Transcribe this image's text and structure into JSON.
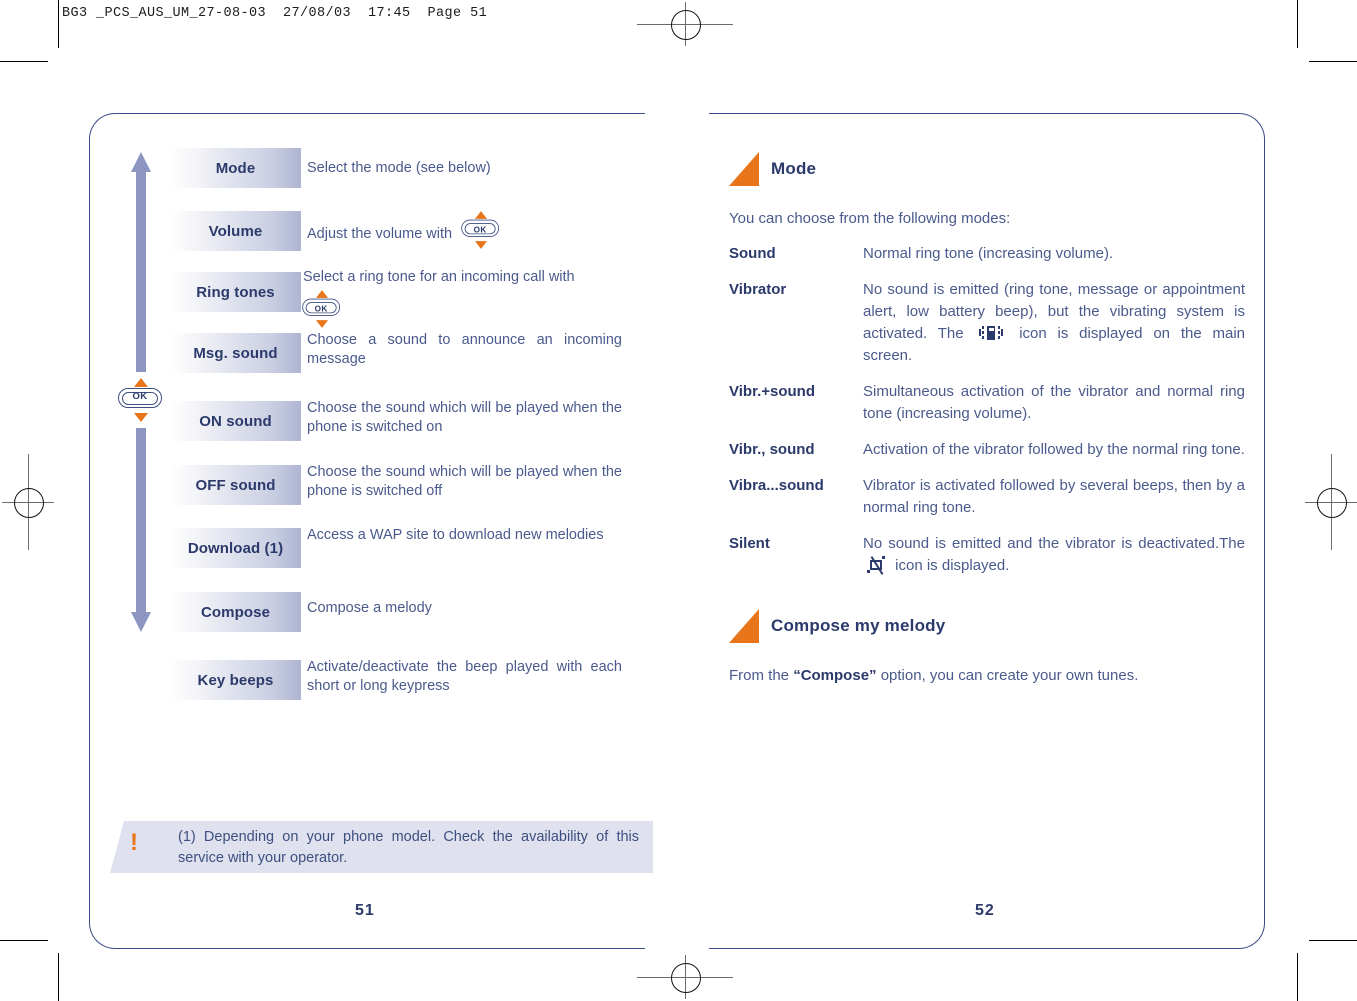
{
  "slug": "BG3 _PCS_AUS_UM_27-08-03  27/08/03  17:45  Page 51",
  "colors": {
    "accent_orange": "#e8751a",
    "text_blue": "#4a5a8c",
    "heading_blue": "#2b3a6b",
    "border_blue": "#3a4a86",
    "button_gradient_end": "#aeb5d2",
    "note_bg": "#dfe2ee"
  },
  "left_page": {
    "page_number": "51",
    "menu": [
      {
        "label": "Mode",
        "desc": "Select the mode (see below)",
        "ok_key": false
      },
      {
        "label": "Volume",
        "desc": "Adjust the volume with ",
        "ok_key": true
      },
      {
        "label": "Ring tones",
        "desc": "Select a ring tone for an incoming call with ",
        "ok_key": true
      },
      {
        "label": "Msg. sound",
        "desc": "Choose a sound to announce an incoming message",
        "ok_key": false
      },
      {
        "label": "ON sound",
        "desc": "Choose the sound which will be played when the phone is switched on",
        "ok_key": false
      },
      {
        "label": "OFF sound",
        "desc": "Choose the sound which will be played when the phone is switched off",
        "ok_key": false
      },
      {
        "label": "Download (1)",
        "desc": "Access a WAP site to download new melodies",
        "ok_key": false
      },
      {
        "label": "Compose",
        "desc": "Compose a melody",
        "ok_key": false
      },
      {
        "label": "Key beeps",
        "desc": "Activate/deactivate the beep played with each short or long keypress",
        "ok_key": false
      }
    ],
    "ok_key_label": "OK",
    "footnote": {
      "marker": "!",
      "line1": "(1) Depending on your phone model. Check the",
      "line2": "availability of this service with your operator."
    }
  },
  "right_page": {
    "page_number": "52",
    "section_mode": {
      "heading": "Mode",
      "lead": "You can choose from the following modes:",
      "modes": [
        {
          "term": "Sound",
          "def_before": "Normal ring tone (increasing volume).",
          "icon": null,
          "def_after": ""
        },
        {
          "term": "Vibrator",
          "def_before": "No sound is emitted (ring tone, message or appointment alert, low battery beep), but the vibrating system is activated. The ",
          "icon": "vibrate-icon",
          "def_after": " icon is displayed on the main screen."
        },
        {
          "term": "Vibr.+sound",
          "def_before": "Simultaneous activation of the vibrator and normal ring tone (increasing volume).",
          "icon": null,
          "def_after": ""
        },
        {
          "term": "Vibr., sound",
          "def_before": "Activation of the vibrator followed by the normal ring tone.",
          "icon": null,
          "def_after": ""
        },
        {
          "term": "Vibra...sound",
          "def_before": "Vibrator is activated followed by several beeps, then by a normal ring tone.",
          "icon": null,
          "def_after": ""
        },
        {
          "term": "Silent",
          "def_before": "No sound is emitted and the vibrator is deactivated.The ",
          "icon": "silent-icon",
          "def_after": " icon is displayed."
        }
      ]
    },
    "section_compose": {
      "heading": "Compose my melody",
      "text_before": "From the ",
      "text_bold": "“Compose”",
      "text_after": " option, you can create your own tunes."
    }
  }
}
